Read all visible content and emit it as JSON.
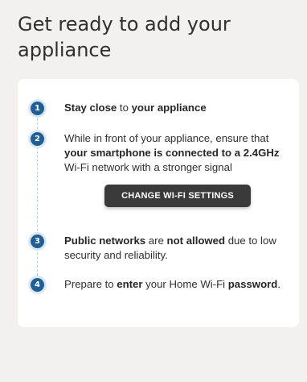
{
  "page": {
    "title": "Get ready to add your appliance"
  },
  "steps": [
    {
      "number": "1",
      "parts": [
        {
          "t": "Stay close",
          "b": true
        },
        {
          "t": " to ",
          "b": false
        },
        {
          "t": "your appliance",
          "b": true
        }
      ]
    },
    {
      "number": "2",
      "parts": [
        {
          "t": "While in front of your appliance, ensure that ",
          "b": false
        },
        {
          "t": "your smartphone is connected to a 2.4GHz",
          "b": true
        },
        {
          "t": " Wi-Fi network with a stronger signal",
          "b": false
        }
      ]
    },
    {
      "number": "3",
      "parts": [
        {
          "t": "Public networks",
          "b": true
        },
        {
          "t": " are ",
          "b": false
        },
        {
          "t": "not allowed",
          "b": true
        },
        {
          "t": " due to low security and reliability.",
          "b": false
        }
      ]
    },
    {
      "number": "4",
      "parts": [
        {
          "t": "Prepare to ",
          "b": false
        },
        {
          "t": "enter",
          "b": true
        },
        {
          "t": " your Home Wi-Fi ",
          "b": false
        },
        {
          "t": "password",
          "b": true
        },
        {
          "t": ".",
          "b": false
        }
      ]
    }
  ],
  "button": {
    "change_wifi_label": "CHANGE WI-FI SETTINGS"
  },
  "colors": {
    "badge": "#1f5f95",
    "button_bg": "#3a3a3a",
    "background": "#f2f1ef"
  }
}
